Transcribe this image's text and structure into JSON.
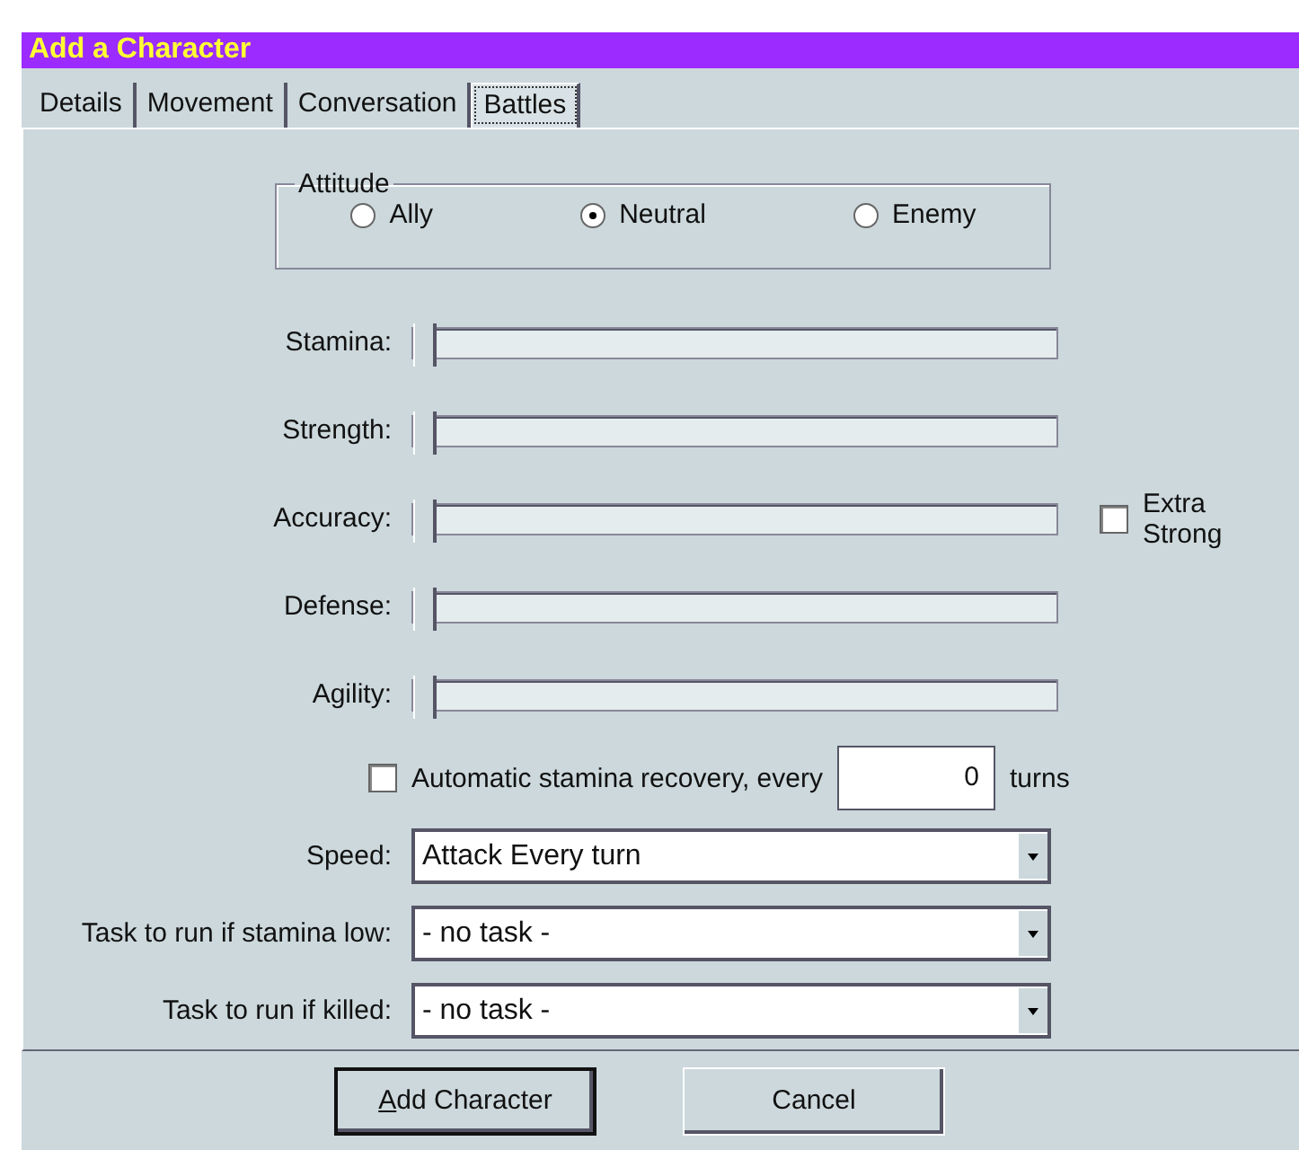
{
  "window": {
    "title": "Add a Character"
  },
  "tabs": [
    {
      "label": "Details",
      "selected": false
    },
    {
      "label": "Movement",
      "selected": false
    },
    {
      "label": "Conversation",
      "selected": false
    },
    {
      "label": "Battles",
      "selected": true
    }
  ],
  "attitude": {
    "title": "Attitude",
    "options": [
      {
        "label": "Ally",
        "selected": false
      },
      {
        "label": "Neutral",
        "selected": true
      },
      {
        "label": "Enemy",
        "selected": false
      }
    ]
  },
  "sliders": [
    {
      "label": "Stamina:",
      "level": 0
    },
    {
      "label": "Strength:",
      "level": 0
    },
    {
      "label": "Accuracy:",
      "level": 0
    },
    {
      "label": "Defense:",
      "level": 0
    },
    {
      "label": "Agility:",
      "level": 0
    }
  ],
  "extra_strong": {
    "label": "Extra Strong",
    "checked": false
  },
  "recovery": {
    "label": "Automatic stamina recovery, every",
    "checked": false,
    "value": "0",
    "suffix": "turns"
  },
  "dropdowns": [
    {
      "label": "Speed:",
      "value": "Attack Every turn"
    },
    {
      "label": "Task to run if stamina low:",
      "value": "- no task -"
    },
    {
      "label": "Task to run if killed:",
      "value": "- no task -"
    }
  ],
  "buttons": [
    {
      "label": "Add Character",
      "default": true
    },
    {
      "label": "Cancel",
      "default": false
    }
  ]
}
